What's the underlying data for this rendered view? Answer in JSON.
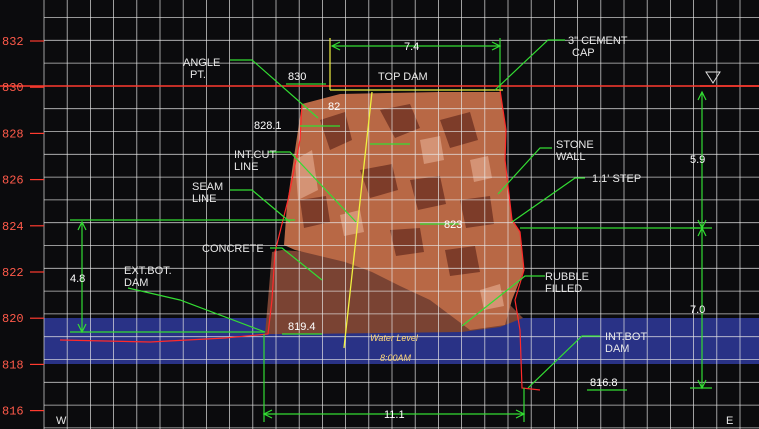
{
  "y_ticks": [
    "832",
    "830",
    "828",
    "826",
    "824",
    "822",
    "820",
    "818",
    "816"
  ],
  "colors": {
    "background": "#0b0b0d",
    "grid": "#e6e6e6",
    "water": "#2f3a9c",
    "leader": "#33dd33",
    "datum": "#ff3b2f",
    "outline": "#ff2a2a",
    "plumb": "#f0f040",
    "concrete": "#7a4333",
    "stone": "#b86845"
  },
  "labels": {
    "cement_cap": [
      "3\" CEMENT",
      "CAP"
    ],
    "angle_pt": [
      "ANGLE",
      "PT."
    ],
    "top_dam_elev": "830",
    "top_dam": "TOP DAM",
    "elev_828_1": "828.1",
    "elev_82x": "82",
    "int_cut": [
      "INT.CUT",
      "LINE"
    ],
    "seam": [
      "SEAM",
      "LINE"
    ],
    "stone_wall": [
      "STONE",
      "WALL"
    ],
    "step": "1.1' STEP",
    "elev_823": "823",
    "concrete": "CONCRETE",
    "ext_bot": [
      "EXT.BOT.",
      "DAM"
    ],
    "rubble": [
      "RUBBLE",
      "FILLED"
    ],
    "elev_819_4": "819.4",
    "int_bot": [
      "INT.BOT",
      "DAM"
    ],
    "elev_816_8": "816.8",
    "water_1": "Water Level",
    "water_2": "8:00AM",
    "west": "W",
    "east": "E"
  },
  "dims": {
    "top_width": "7.4",
    "height_upper": "5.9",
    "height_lower": "7.0",
    "ext_height": "4.8",
    "base_width": "11.1"
  }
}
